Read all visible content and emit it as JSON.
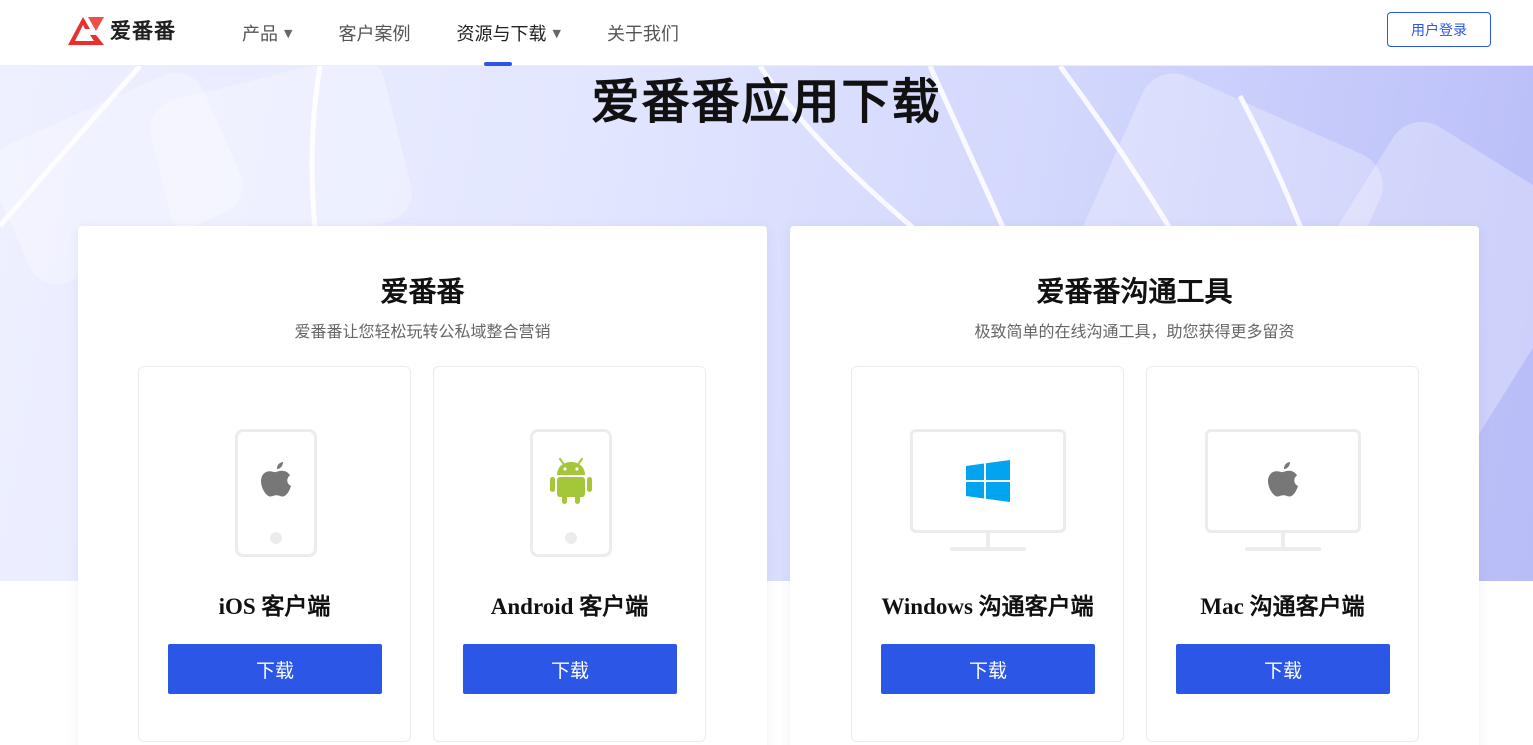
{
  "header": {
    "logo_text": "爱番番",
    "nav": [
      {
        "label": "产品",
        "has_caret": true,
        "active": false
      },
      {
        "label": "客户案例",
        "has_caret": false,
        "active": false
      },
      {
        "label": "资源与下载",
        "has_caret": true,
        "active": true
      },
      {
        "label": "关于我们",
        "has_caret": false,
        "active": false
      }
    ],
    "caret_glyph": "▼",
    "login_label": "用户登录"
  },
  "hero": {
    "title": "爱番番应用下载"
  },
  "panels": [
    {
      "title": "爱番番",
      "subtitle": "爱番番让您轻松玩转公私域整合营销",
      "cards": [
        {
          "title": "iOS 客户端",
          "button": "下载",
          "icon": "apple-icon",
          "device": "phone"
        },
        {
          "title": "Android 客户端",
          "button": "下载",
          "icon": "android-icon",
          "device": "phone"
        }
      ]
    },
    {
      "title": "爱番番沟通工具",
      "subtitle": "极致简单的在线沟通工具，助您获得更多留资",
      "cards": [
        {
          "title": "Windows 沟通客户端",
          "button": "下载",
          "icon": "windows-icon",
          "device": "monitor"
        },
        {
          "title": "Mac 沟通客户端",
          "button": "下载",
          "icon": "apple-icon",
          "device": "monitor"
        }
      ]
    }
  ],
  "colors": {
    "accent": "#2b56e6",
    "logo_red": "#e8312f",
    "android_green": "#a4c639",
    "windows_blue": "#00a4ef",
    "apple_gray": "#777777"
  }
}
